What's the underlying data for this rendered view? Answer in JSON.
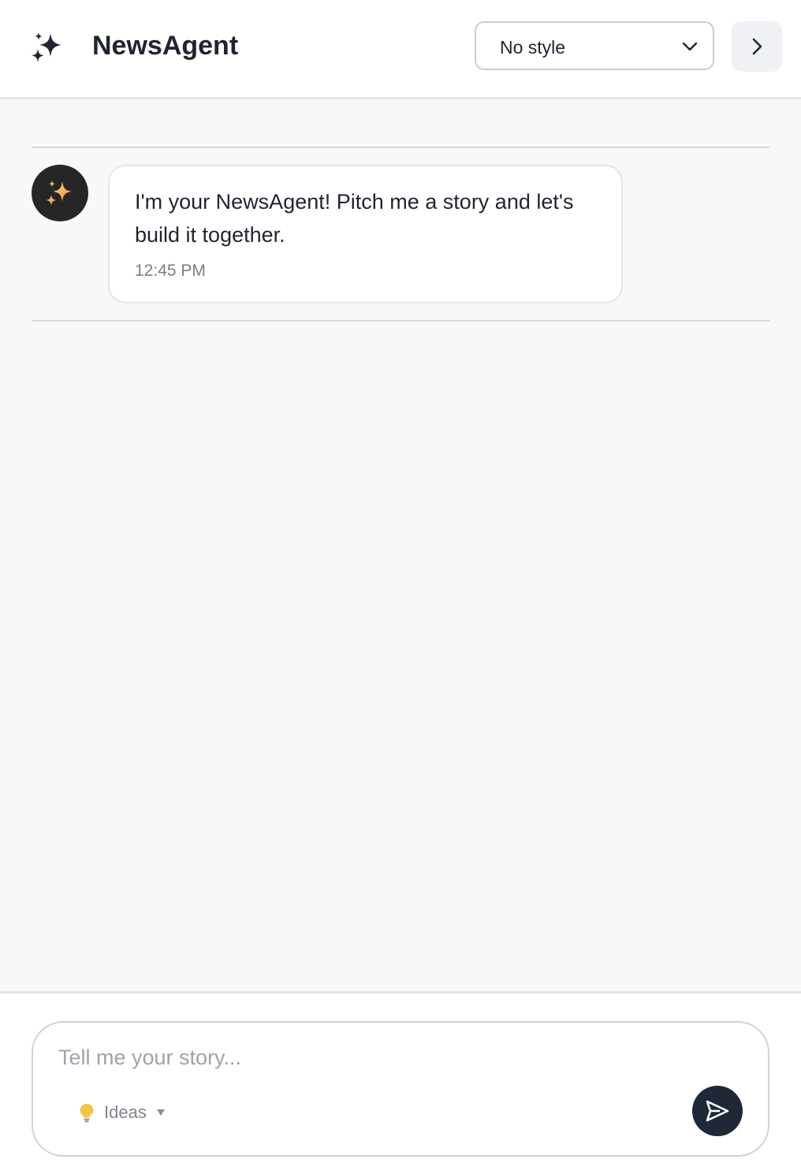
{
  "header": {
    "title": "NewsAgent",
    "logo_icon": "sparkles-icon",
    "style_select": {
      "value": "No style",
      "icon": "chevron-down-icon"
    },
    "panel_toggle_icon": "chevron-right-icon"
  },
  "chat": {
    "messages": [
      {
        "sender": "agent",
        "avatar_icon": "sparkles-icon",
        "text": "I'm your NewsAgent! Pitch me a story and let's build it together.",
        "time": "12:45 PM"
      }
    ]
  },
  "composer": {
    "placeholder": "Tell me your story...",
    "value": "",
    "ideas_label": "Ideas",
    "ideas_icon": "lightbulb-icon",
    "ideas_caret_icon": "caret-down-icon",
    "send_icon": "send-icon"
  },
  "colors": {
    "header_bg": "#ffffff",
    "chat_bg": "#f7f8fa",
    "avatar_bg": "#262626",
    "send_button_bg": "#1f2836",
    "sparkle_gold": "#f2b94b"
  }
}
